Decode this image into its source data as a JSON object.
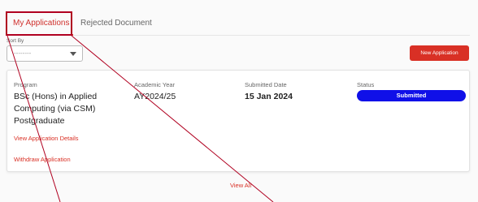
{
  "tabs": [
    {
      "label": "My Applications",
      "active": true
    },
    {
      "label": "Rejected Document",
      "active": false
    }
  ],
  "sort": {
    "label": "Sort By",
    "value": "--------"
  },
  "new_application_label": "New Application",
  "application": {
    "program_label": "Program",
    "program_value": "BSc (Hons) in Applied Computing (via CSM) Postgraduate",
    "year_label": "Academic Year",
    "year_value": "AY2024/25",
    "date_label": "Submitted Date",
    "date_value": "15 Jan 2024",
    "status_label": "Status",
    "status_value": "Submitted",
    "details_link": "View Application Details",
    "withdraw_link": "Withdraw Application"
  },
  "view_all_label": "View All",
  "colors": {
    "accent": "#d93025",
    "status_badge": "#1010e8",
    "annotation": "#b00020"
  }
}
